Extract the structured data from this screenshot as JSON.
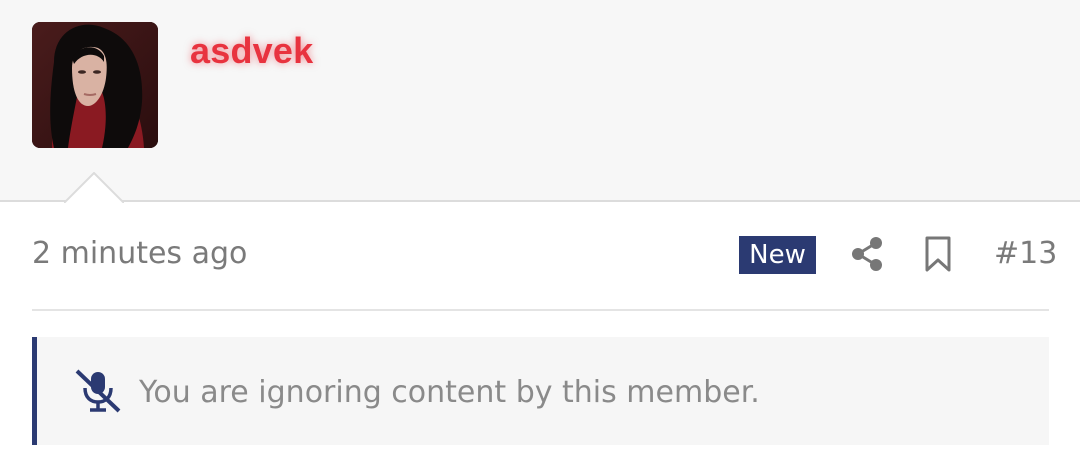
{
  "post": {
    "author": {
      "username": "asdvek",
      "username_color": "#e8333f",
      "avatar_icon": "avatar-photo"
    },
    "timestamp": "2 minutes ago",
    "badge": "New",
    "badge_color": "#2b3a72",
    "actions": {
      "share_icon": "share-icon",
      "bookmark_icon": "bookmark-icon"
    },
    "number": "#13",
    "ignored_notice": {
      "icon": "mute-icon",
      "text": "You are ignoring content by this member."
    }
  }
}
